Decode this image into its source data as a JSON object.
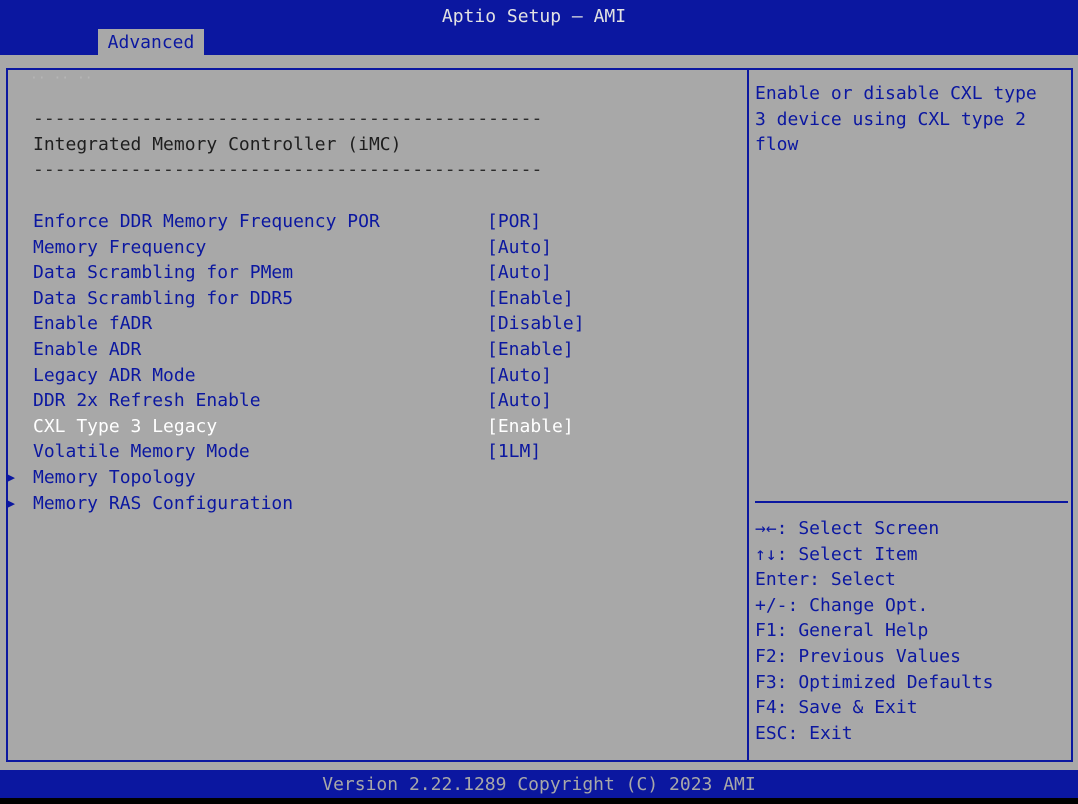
{
  "header": {
    "app_title": "Aptio Setup – AMI",
    "active_tab": "Advanced"
  },
  "main": {
    "faded_label": "·· ·· ··",
    "separator": "-----------------------------------------------",
    "section_title": "Integrated Memory Controller (iMC)",
    "settings": [
      {
        "label": "Enforce DDR Memory Frequency POR",
        "value": "[POR]"
      },
      {
        "label": "Memory Frequency",
        "value": "[Auto]"
      },
      {
        "label": "Data Scrambling for PMem",
        "value": "[Auto]"
      },
      {
        "label": "Data Scrambling for DDR5",
        "value": "[Enable]"
      },
      {
        "label": "Enable fADR",
        "value": "[Disable]"
      },
      {
        "label": "Enable ADR",
        "value": "[Enable]"
      },
      {
        "label": "Legacy ADR Mode",
        "value": "[Auto]"
      },
      {
        "label": "DDR 2x Refresh Enable",
        "value": "[Auto]"
      },
      {
        "label": "CXL Type 3 Legacy",
        "value": "[Enable]"
      },
      {
        "label": "Volatile Memory Mode",
        "value": "[1LM]"
      }
    ],
    "selected_setting": "CXL Type 3 Legacy",
    "submenus": [
      {
        "label": "Memory Topology",
        "icon": "triangle-right-icon"
      },
      {
        "label": "Memory RAS Configuration",
        "icon": "triangle-right-icon"
      }
    ]
  },
  "help": {
    "description": [
      "Enable or disable CXL type",
      "3 device using CXL type 2",
      "flow"
    ]
  },
  "keys": [
    "→←: Select Screen",
    "↑↓: Select Item",
    "Enter: Select",
    "+/-: Change Opt.",
    "F1: General Help",
    "F2: Previous Values",
    "F3: Optimized Defaults",
    "F4: Save & Exit",
    "ESC: Exit"
  ],
  "footer": {
    "version": "Version 2.22.1289 Copyright (C) 2023 AMI"
  },
  "colors": {
    "bios_blue": "#0b17a0",
    "panel_gray": "#a8a8a8",
    "selected_text": "#ffffff"
  }
}
